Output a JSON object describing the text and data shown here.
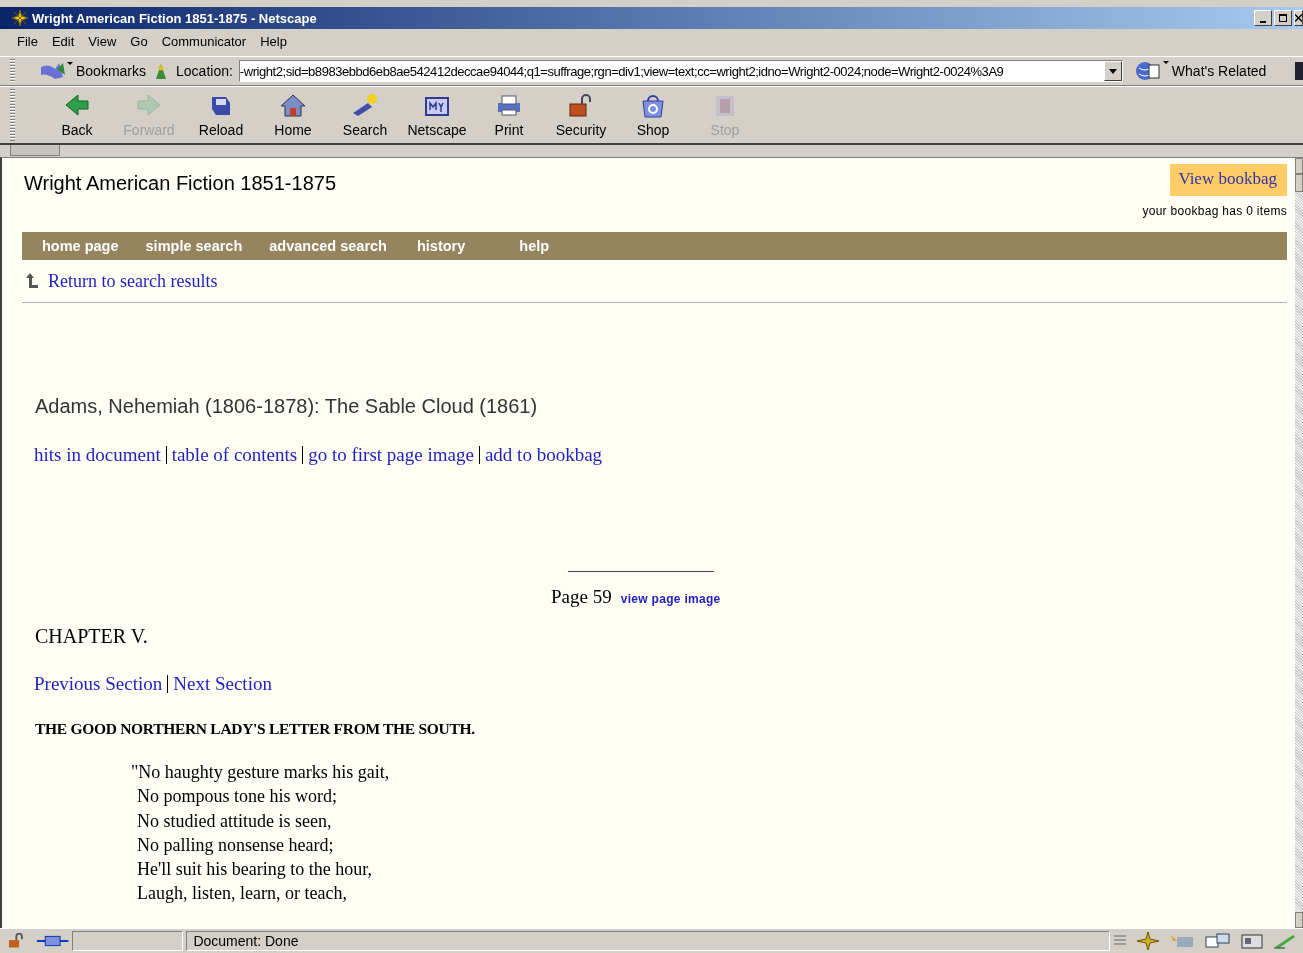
{
  "window": {
    "title": "Wright American Fiction 1851-1875 - Netscape"
  },
  "menu": [
    "File",
    "Edit",
    "View",
    "Go",
    "Communicator",
    "Help"
  ],
  "location_bar": {
    "bookmarks": "Bookmarks",
    "label": "Location:",
    "value": "-wright2;sid=b8983ebbd6eb8ae542412deccae94044;q1=suffrage;rgn=div1;view=text;cc=wright2;idno=Wright2-0024;node=Wright2-0024%3A9",
    "related": "What's Related"
  },
  "toolbar": [
    {
      "label": "Back",
      "disabled": false
    },
    {
      "label": "Forward",
      "disabled": true
    },
    {
      "label": "Reload",
      "disabled": false
    },
    {
      "label": "Home",
      "disabled": false
    },
    {
      "label": "Search",
      "disabled": false
    },
    {
      "label": "Netscape",
      "disabled": false
    },
    {
      "label": "Print",
      "disabled": false
    },
    {
      "label": "Security",
      "disabled": false
    },
    {
      "label": "Shop",
      "disabled": false
    },
    {
      "label": "Stop",
      "disabled": true
    }
  ],
  "page": {
    "site_title": "Wright American Fiction 1851-1875",
    "bookbag_button": "View bookbag",
    "bookbag_count": "your bookbag has 0 items",
    "nav": [
      "home page",
      "simple search",
      "advanced search",
      "history",
      "help"
    ],
    "return_link": "Return to search results",
    "document_title": "Adams, Nehemiah (1806-1878): The Sable Cloud (1861)",
    "doc_links": [
      "hits in document",
      "table of contents",
      "go to first page image",
      "add to bookbag"
    ],
    "page_label": "Page 59",
    "page_image_link": "view page image",
    "chapter": "CHAPTER V.",
    "section_links": [
      "Previous Section",
      "Next Section"
    ],
    "heading": "THE GOOD NORTHERN LADY'S LETTER FROM THE SOUTH.",
    "poem": [
      "\"No haughty gesture marks his gait,",
      "No pompous tone his word;",
      "No studied attitude is seen,",
      "No palling nonsense heard;",
      "He'll suit his bearing to the hour,",
      "Laugh, listen, learn, or teach,"
    ]
  },
  "status_bar": {
    "text": "Document: Done"
  }
}
